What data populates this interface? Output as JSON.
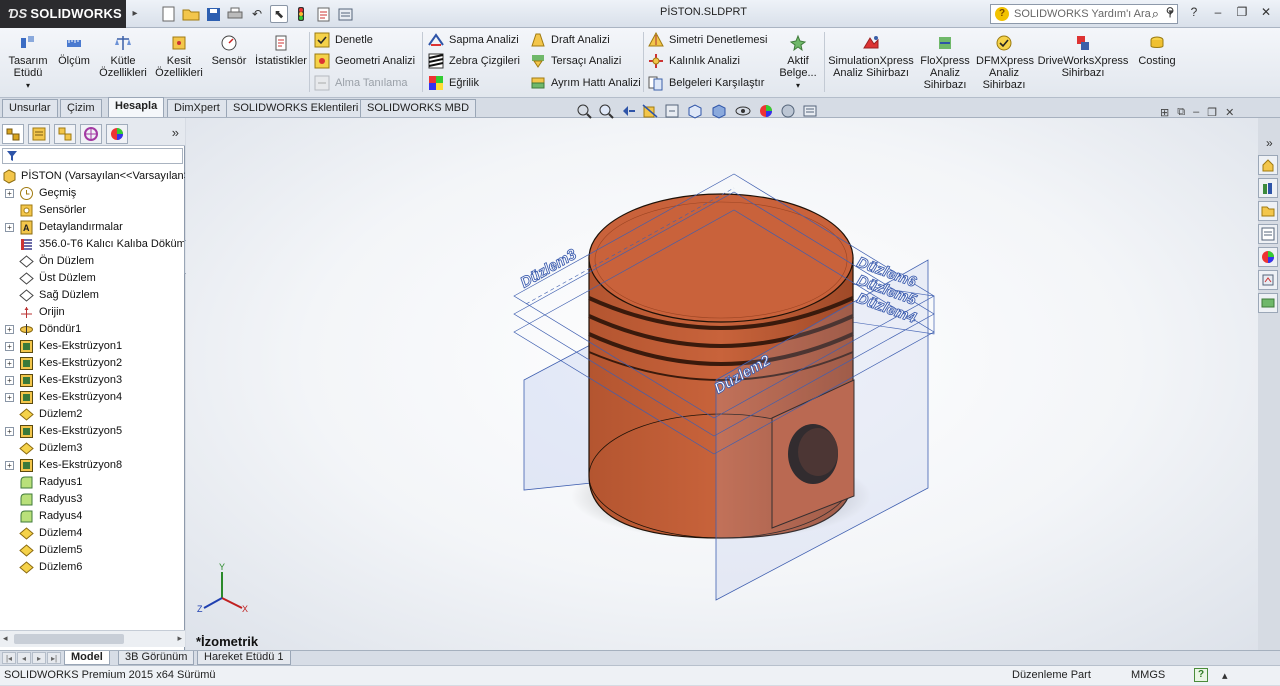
{
  "app": {
    "brand": "SOLIDWORKS",
    "document_title": "PİSTON.SLDPRT",
    "help_search_placeholder": "SOLIDWORKS Yardım'ı Ara"
  },
  "ribbon": {
    "large_buttons": [
      {
        "line1": "Tasarım",
        "line2": "Etüdü",
        "icon": "design-study-icon"
      },
      {
        "line1": "Ölçüm",
        "line2": "",
        "icon": "measure-icon"
      },
      {
        "line1": "Kütle",
        "line2": "Özellikleri",
        "icon": "mass-properties-icon"
      },
      {
        "line1": "Kesit",
        "line2": "Özellikleri",
        "icon": "section-properties-icon"
      },
      {
        "line1": "Sensör",
        "line2": "",
        "icon": "sensor-icon"
      },
      {
        "line1": "İstatistikler",
        "line2": "",
        "icon": "statistics-icon"
      }
    ],
    "check_group": [
      {
        "label": "Denetle",
        "enabled": true
      },
      {
        "label": "Geometri Analizi",
        "enabled": true
      },
      {
        "label": "Alma Tanılama",
        "enabled": false
      }
    ],
    "analysis_group": [
      {
        "label": "Sapma Analizi"
      },
      {
        "label": "Zebra Çizgileri"
      },
      {
        "label": "Eğrilik"
      }
    ],
    "draft_group": [
      {
        "label": "Draft Analizi"
      },
      {
        "label": "Tersaçı Analizi"
      },
      {
        "label": "Ayrım Hattı Analizi"
      }
    ],
    "symmetry_group": [
      {
        "label": "Simetri Denetlemesi"
      },
      {
        "label": "Kalınlık Analizi"
      },
      {
        "label": "Belgeleri  Karşılaştır"
      }
    ],
    "active_button": {
      "line1": "Aktif",
      "line2": "Belge..."
    },
    "xpress_buttons": [
      {
        "line1": "SimulationXpress",
        "line2": "Analiz Sihirbazı",
        "line3": ""
      },
      {
        "line1": "FloXpress",
        "line2": "Analiz",
        "line3": "Sihirbazı"
      },
      {
        "line1": "DFMXpress",
        "line2": "Analiz",
        "line3": "Sihirbazı"
      },
      {
        "line1": "DriveWorksXpress",
        "line2": "Sihirbazı",
        "line3": ""
      },
      {
        "line1": "Costing",
        "line2": "",
        "line3": ""
      }
    ]
  },
  "command_tabs": [
    "Unsurlar",
    "Çizim",
    "Hesapla",
    "DimXpert",
    "SOLIDWORKS Eklentileri",
    "SOLIDWORKS MBD"
  ],
  "active_command_tab": "Hesapla",
  "feature_tree": {
    "root": "PİSTON  (Varsayılan<<Varsayılan>",
    "items": [
      {
        "label": "Geçmiş",
        "icon": "history-icon",
        "expandable": true
      },
      {
        "label": "Sensörler",
        "icon": "sensors-icon",
        "expandable": false
      },
      {
        "label": "Detaylandırmalar",
        "icon": "annotations-icon",
        "expandable": true
      },
      {
        "label": "356.0-T6 Kalıcı Kalıba Döküm",
        "icon": "material-icon",
        "expandable": false
      },
      {
        "label": "Ön Düzlem",
        "icon": "plane-icon",
        "expandable": false
      },
      {
        "label": "Üst Düzlem",
        "icon": "plane-icon",
        "expandable": false
      },
      {
        "label": "Sağ Düzlem",
        "icon": "plane-icon",
        "expandable": false
      },
      {
        "label": "Orijin",
        "icon": "origin-icon",
        "expandable": false
      },
      {
        "label": "Döndür1",
        "icon": "revolve-icon",
        "expandable": true
      },
      {
        "label": "Kes-Ekstrüzyon1",
        "icon": "cut-extrude-icon",
        "expandable": true
      },
      {
        "label": "Kes-Ekstrüzyon2",
        "icon": "cut-extrude-icon",
        "expandable": true
      },
      {
        "label": "Kes-Ekstrüzyon3",
        "icon": "cut-extrude-icon",
        "expandable": true
      },
      {
        "label": "Kes-Ekstrüzyon4",
        "icon": "cut-extrude-icon",
        "expandable": true
      },
      {
        "label": "Düzlem2",
        "icon": "plane-feature-icon",
        "expandable": false
      },
      {
        "label": "Kes-Ekstrüzyon5",
        "icon": "cut-extrude-icon",
        "expandable": true
      },
      {
        "label": "Düzlem3",
        "icon": "plane-feature-icon",
        "expandable": false
      },
      {
        "label": "Kes-Ekstrüzyon8",
        "icon": "cut-extrude-icon",
        "expandable": true
      },
      {
        "label": "Radyus1",
        "icon": "fillet-icon",
        "expandable": false
      },
      {
        "label": "Radyus3",
        "icon": "fillet-icon",
        "expandable": false
      },
      {
        "label": "Radyus4",
        "icon": "fillet-icon",
        "expandable": false
      },
      {
        "label": "Düzlem4",
        "icon": "plane-feature-icon",
        "expandable": false
      },
      {
        "label": "Düzlem5",
        "icon": "plane-feature-icon",
        "expandable": false
      },
      {
        "label": "Düzlem6",
        "icon": "plane-feature-icon",
        "expandable": false
      }
    ]
  },
  "viewport": {
    "view_name": "*İzometrik",
    "plane_labels": [
      "Düzlem3",
      "Düzlem2",
      "Düzlem6",
      "Düzlem5",
      "Düzlem4"
    ],
    "axis_labels": {
      "x": "X",
      "y": "Y",
      "z": "Z"
    },
    "part_color": "#c8633b",
    "plane_color": "#3f5fb0"
  },
  "bottom_tabs": [
    "Model",
    "3B Görünüm",
    "Hareket Etüdü 1"
  ],
  "active_bottom_tab": "Model",
  "status": {
    "version": "SOLIDWORKS Premium 2015 x64 Sürümü",
    "mode": "Düzenleme Part",
    "units": "MMGS",
    "help_glyph": "?",
    "more": "▴"
  }
}
